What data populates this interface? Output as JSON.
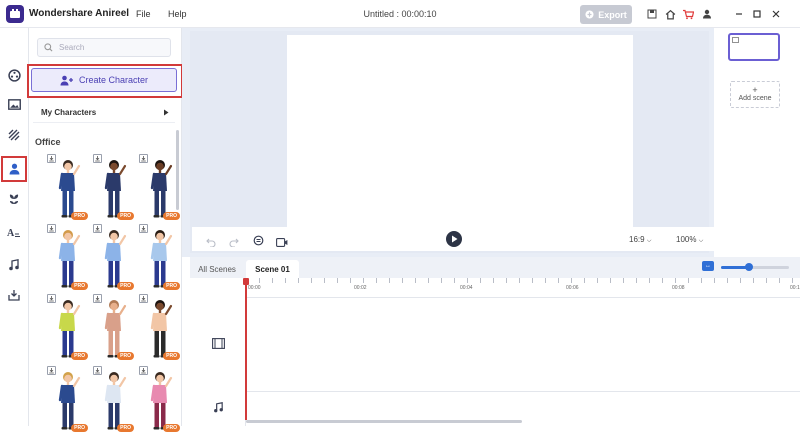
{
  "app": {
    "name": "Wondershare Anireel",
    "doc_title": "Untitled : 00:00:10"
  },
  "menu": [
    {
      "label": "File"
    },
    {
      "label": "Help"
    }
  ],
  "toolbar": {
    "export_label": "Export"
  },
  "left_panel": {
    "search_placeholder": "Search",
    "create_label": "Create Character",
    "my_characters_label": "My Characters",
    "section_title": "Office",
    "characters": [
      {
        "pro": "PRO",
        "skin": "#f2c6a6",
        "hair": "#3a2a20",
        "top": "#2b4a8f",
        "bottom": "#2b4a8f"
      },
      {
        "pro": "PRO",
        "skin": "#7b4a2e",
        "hair": "#1d1410",
        "top": "#2b3a6a",
        "bottom": "#2b3a6a"
      },
      {
        "pro": "PRO",
        "skin": "#6a3d25",
        "hair": "#1d1410",
        "top": "#2b3a6a",
        "bottom": "#2b3a6a"
      },
      {
        "pro": "PRO",
        "skin": "#f2c6a6",
        "hair": "#d29a4a",
        "top": "#8cb3e8",
        "bottom": "#2b3a8f"
      },
      {
        "pro": "PRO",
        "skin": "#f2c6a6",
        "hair": "#3a2a20",
        "top": "#8cb3e8",
        "bottom": "#2b3a8f"
      },
      {
        "pro": "PRO",
        "skin": "#f2c6a6",
        "hair": "#2a1d14",
        "top": "#a8c8ec",
        "bottom": "#2b3a8f"
      },
      {
        "pro": "PRO",
        "skin": "#f2c6a6",
        "hair": "#3a2a20",
        "top": "#c8d84a",
        "bottom": "#2b3a8f"
      },
      {
        "pro": "PRO",
        "skin": "#e8b08c",
        "hair": "#b07a55",
        "top": "#d9a08a",
        "bottom": "#d9a08a"
      },
      {
        "pro": "PRO",
        "skin": "#7b4a2e",
        "hair": "#1d1410",
        "top": "#f2c6a6",
        "bottom": "#2b2b2b"
      },
      {
        "pro": "PRO",
        "skin": "#f2c6a6",
        "hair": "#d2a24a",
        "top": "#2b4a8f",
        "bottom": "#2b3a6a"
      },
      {
        "pro": "PRO",
        "skin": "#f2c6a6",
        "hair": "#3a2a20",
        "top": "#dde6f2",
        "bottom": "#2b3a6a"
      },
      {
        "pro": "PRO",
        "skin": "#f2c6a6",
        "hair": "#3a2a20",
        "top": "#e88ab0",
        "bottom": "#8a2a4a"
      }
    ]
  },
  "preview": {
    "ratio": "16:9",
    "zoom": "100%"
  },
  "scenes_panel": {
    "add_label": "Add scene"
  },
  "timeline": {
    "tabs": [
      {
        "label": "All Scenes"
      },
      {
        "label": "Scene 01"
      }
    ],
    "ruler": [
      "00:00",
      "00:02",
      "00:04",
      "00:06",
      "00:08",
      "00:1"
    ]
  },
  "colors": {
    "accent": "#4a3fb3",
    "highlight": "#d23a3a",
    "pro_badge": "#e8782f",
    "primary_blue": "#2f6fd6"
  }
}
